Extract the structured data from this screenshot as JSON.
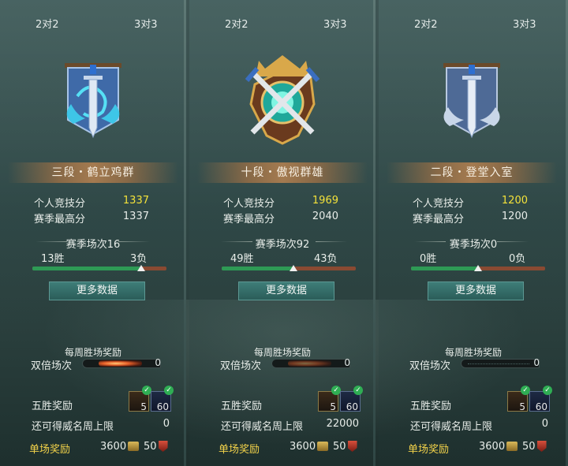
{
  "columns": [
    {
      "tabs": {
        "left": "2对2",
        "right": "3对3"
      },
      "emblem": "blue-banner-dragon-sword-emblem",
      "rank_name": "三段・鹤立鸡群",
      "personal_score_label": "个人竞技分",
      "personal_score": "1337",
      "season_high_label": "赛季最高分",
      "season_high": "1337",
      "season_matches": "赛季场次16",
      "wins": "13胜",
      "losses": "3负",
      "win_ratio": 0.8125,
      "more_data": "更多数据",
      "weekly_title": "每周胜场奖励",
      "double_label": "双倍场次",
      "double_count": "0",
      "five_win_label": "五胜奖励",
      "reward1_count": "5",
      "reward2_count": "60",
      "limit_label": "还可得威名周上限",
      "limit_value": "0",
      "single_label": "单场奖励",
      "single_coin": "3600",
      "single_medal": "50"
    },
    {
      "tabs": {
        "left": "2对2",
        "right": "3对3"
      },
      "emblem": "gold-shield-crossed-swords-emblem",
      "rank_name": "十段・傲视群雄",
      "personal_score_label": "个人竞技分",
      "personal_score": "1969",
      "season_high_label": "赛季最高分",
      "season_high": "2040",
      "season_matches": "赛季场次92",
      "wins": "49胜",
      "losses": "43负",
      "win_ratio": 0.5326,
      "more_data": "更多数据",
      "weekly_title": "每周胜场奖励",
      "double_label": "双倍场次",
      "double_count": "0",
      "five_win_label": "五胜奖励",
      "reward1_count": "5",
      "reward2_count": "60",
      "limit_label": "还可得威名周上限",
      "limit_value": "22000",
      "single_label": "单场奖励",
      "single_coin": "3600",
      "single_medal": "50"
    },
    {
      "tabs": {
        "left": "2对2",
        "right": "3对3"
      },
      "emblem": "steel-banner-sword-emblem",
      "rank_name": "二段・登堂入室",
      "personal_score_label": "个人竞技分",
      "personal_score": "1200",
      "season_high_label": "赛季最高分",
      "season_high": "1200",
      "season_matches": "赛季场次0",
      "wins": "0胜",
      "losses": "0负",
      "win_ratio": 0.5,
      "more_data": "更多数据",
      "weekly_title": "每周胜场奖励",
      "double_label": "双倍场次",
      "double_count": "0",
      "five_win_label": "五胜奖励",
      "reward1_count": "5",
      "reward2_count": "60",
      "limit_label": "还可得威名周上限",
      "limit_value": "0",
      "single_label": "单场奖励",
      "single_coin": "3600",
      "single_medal": "50"
    }
  ],
  "colors": {
    "score_highlight": "#f4e23a",
    "win_bar": "#2e9a55",
    "loss_bar": "#8a4a32",
    "reward_label": "#f2d24a"
  }
}
